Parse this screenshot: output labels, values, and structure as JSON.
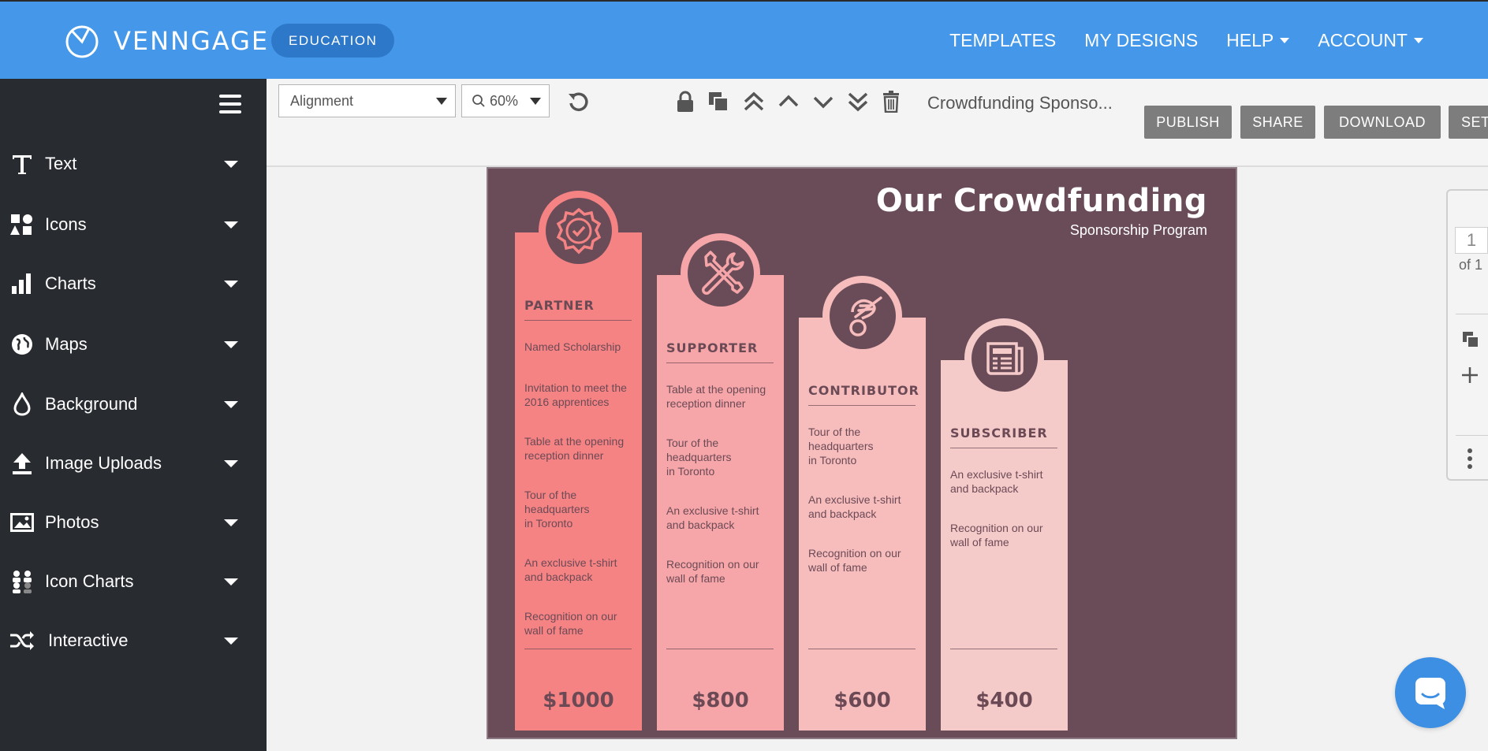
{
  "topbar": {
    "brand": "VENNGAGE",
    "plan_badge": "EDUCATION",
    "nav": [
      {
        "label": "TEMPLATES",
        "dropdown": false
      },
      {
        "label": "MY DESIGNS",
        "dropdown": false
      },
      {
        "label": "HELP",
        "dropdown": true
      },
      {
        "label": "ACCOUNT",
        "dropdown": true
      }
    ],
    "color": "#4598e9"
  },
  "sidebar": {
    "items": [
      {
        "label": "Text",
        "icon": "text-icon"
      },
      {
        "label": "Icons",
        "icon": "shapes-icon"
      },
      {
        "label": "Charts",
        "icon": "bar-chart-icon"
      },
      {
        "label": "Maps",
        "icon": "globe-icon"
      },
      {
        "label": "Background",
        "icon": "droplet-icon"
      },
      {
        "label": "Image Uploads",
        "icon": "upload-icon"
      },
      {
        "label": "Photos",
        "icon": "photo-icon"
      },
      {
        "label": "Icon Charts",
        "icon": "people-icon"
      },
      {
        "label": "Interactive",
        "icon": "shuffle-icon"
      }
    ]
  },
  "toolbar": {
    "alignment": "Alignment",
    "zoom": "60%",
    "doc_title": "Crowdfunding Sponso...",
    "buttons": {
      "publish": "PUBLISH",
      "share": "SHARE",
      "download": "DOWNLOAD",
      "settings": "SET"
    }
  },
  "canvas": {
    "title": "Our Crowdfunding",
    "subtitle": "Sponsorship Program",
    "background": "#6a4c59",
    "tiers": [
      {
        "name": "PARTNER",
        "icon": "badge-check-icon",
        "color": "#f58383",
        "benefits": [
          "Named Scholarship",
          "Invitation to meet the\n2016 apprentices",
          "Table at the opening\nreception dinner",
          "Tour of the\nheadquarters\nin Toronto",
          "An exclusive t-shirt\nand backpack",
          "Recognition on our\nwall of fame"
        ],
        "price": "$1000"
      },
      {
        "name": "SUPPORTER",
        "icon": "tools-icon",
        "color": "#f6a6a8",
        "benefits": [
          "Table at the opening\nreception dinner",
          "Tour of the\nheadquarters\nin Toronto",
          "An exclusive t-shirt\nand backpack",
          "Recognition on our\nwall of fame"
        ],
        "price": "$800"
      },
      {
        "name": "CONTRIBUTOR",
        "icon": "hand-coin-icon",
        "color": "#f7bdbd",
        "benefits": [
          "Tour of the\nheadquarters\nin Toronto",
          "An exclusive t-shirt\nand backpack",
          "Recognition on our\nwall of fame"
        ],
        "price": "$600"
      },
      {
        "name": "SUBSCRIBER",
        "icon": "newspaper-icon",
        "color": "#f5cbca",
        "benefits": [
          "An exclusive t-shirt\nand backpack",
          "Recognition on our\nwall of fame"
        ],
        "price": "$400"
      }
    ]
  },
  "page_panel": {
    "current": "1",
    "total_label": "of 1"
  }
}
